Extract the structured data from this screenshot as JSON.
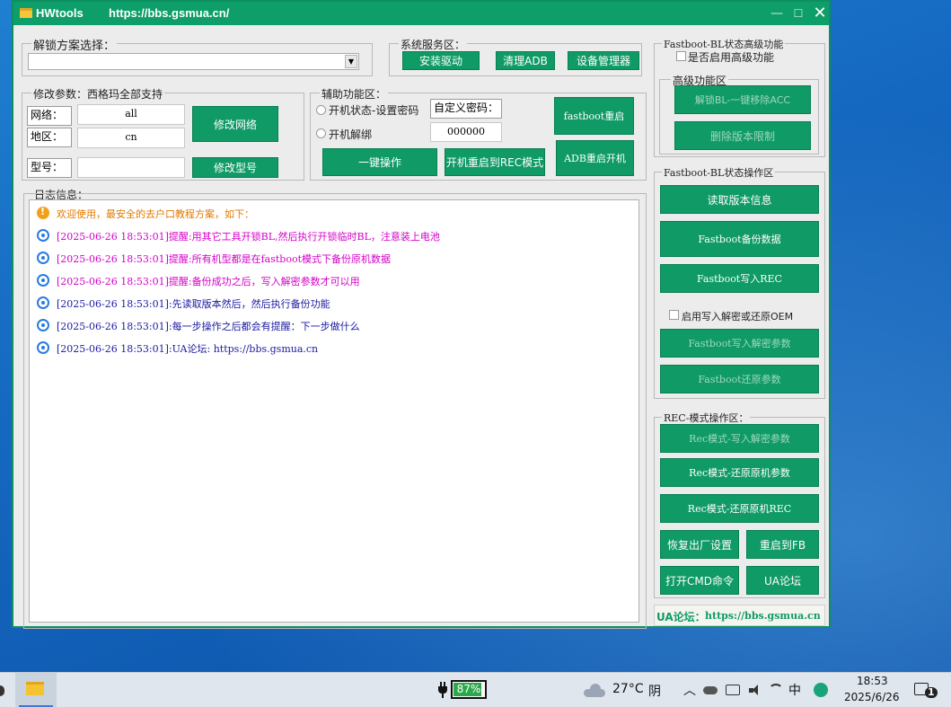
{
  "window": {
    "app_name": "HWtools",
    "url": "https://bbs.gsmua.cn/",
    "minimize_glyph": "—",
    "maximize_glyph": "☐",
    "close_glyph": "✕"
  },
  "unlock_scheme": {
    "label": "解锁方案选择：",
    "selected": ""
  },
  "system_service": {
    "label": "系统服务区：",
    "install_driver": "安装驱动",
    "clear_adb": "清理ADB",
    "device_manager": "设备管理器"
  },
  "modify_params": {
    "label": "修改参数：西格玛全部支持",
    "network_label": "网络：",
    "network_value": "all",
    "region_label": "地区：",
    "region_value": "cn",
    "model_label": "型号：",
    "model_value": "",
    "modify_network": "修改网络",
    "modify_model": "修改型号"
  },
  "aux": {
    "label": "辅助功能区：",
    "radio_boot_set_pwd": "开机状态-设置密码",
    "radio_boot_unlock": "开机解绑",
    "custom_pwd_label": "自定义密码：",
    "pwd_value": "000000",
    "one_click": "一键操作",
    "reboot_rec": "开机重启到REC模式",
    "fastboot_reboot": "fastboot重启",
    "adb_reboot": "ADB重启开机"
  },
  "log": {
    "label": "日志信息：",
    "lines": [
      {
        "text": "欢迎使用，最安全的去户口教程方案，如下：",
        "color": "#e07a00",
        "icon": "warn"
      },
      {
        "text": "[2025-06-26 18:53:01]提醒:用其它工具开锁BL,然后执行开锁临时BL，注意装上电池",
        "color": "#d400c8",
        "icon": "info"
      },
      {
        "text": "[2025-06-26 18:53:01]提醒:所有机型都是在fastboot模式下备份原机数据",
        "color": "#d400c8",
        "icon": "info"
      },
      {
        "text": "[2025-06-26 18:53:01]提醒:备份成功之后，写入解密参数才可以用",
        "color": "#d400c8",
        "icon": "info"
      },
      {
        "text": "[2025-06-26 18:53:01]:先读取版本然后，然后执行备份功能",
        "color": "#1a1aa0",
        "icon": "info"
      },
      {
        "text": "[2025-06-26 18:53:01]:每一步操作之后都会有提醒：下一步做什么",
        "color": "#1a1aa0",
        "icon": "info"
      },
      {
        "text": "[2025-06-26 18:53:01]:UA论坛: https://bbs.gsmua.cn",
        "color": "#1a1aa0",
        "icon": "info"
      }
    ]
  },
  "fastboot_advanced": {
    "label": "Fastboot-BL状态高级功能",
    "enable_advanced": "是否启用高级功能",
    "advanced_area": "高级功能区",
    "unlock_bl_acc": "解锁BL-一键移除ACC",
    "remove_version_limit": "删除版本限制"
  },
  "fastboot_ops": {
    "label": "Fastboot-BL状态操作区",
    "read_version": "读取版本信息",
    "backup": "Fastboot备份数据",
    "write_rec": "Fastboot写入REC",
    "enable_write_oem": "启用写入解密或还原OEM",
    "write_params": "Fastboot写入解密参数",
    "restore_params": "Fastboot还原参数"
  },
  "rec_ops": {
    "label": "REC-模式操作区：",
    "write_params": "Rec模式-写入解密参数",
    "restore_params": "Rec模式-还原原机参数",
    "restore_rec": "Rec模式-还原原机REC",
    "factory_reset": "恢复出厂设置",
    "reboot_fb": "重启到FB",
    "open_cmd": "打开CMD命令",
    "ua_forum": "UA论坛"
  },
  "footer": {
    "forum_label": "UA论坛：",
    "forum_url": "https://bbs.gsmua.cn"
  },
  "taskbar": {
    "battery": "87%",
    "weather_temp": "27°C",
    "weather_cond": "阴",
    "ime": "中",
    "time": "18:53",
    "date": "2025/6/26",
    "notif_count": "1"
  }
}
